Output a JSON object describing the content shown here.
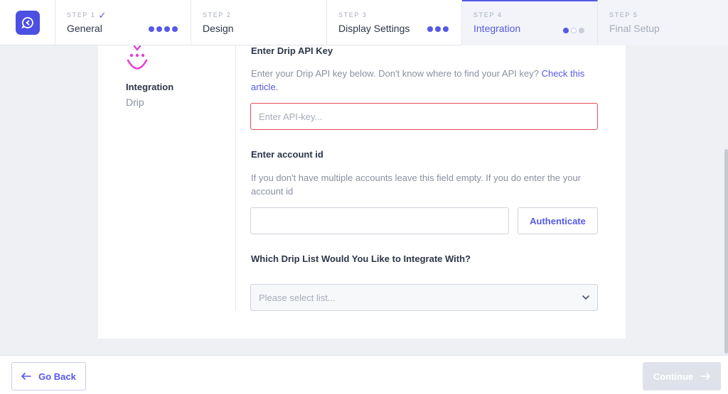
{
  "stepper": {
    "steps": [
      {
        "label": "STEP 1",
        "name": "General"
      },
      {
        "label": "STEP 2",
        "name": "Design"
      },
      {
        "label": "STEP 3",
        "name": "Display Settings"
      },
      {
        "label": "STEP 4",
        "name": "Integration"
      },
      {
        "label": "STEP 5",
        "name": "Final Setup"
      }
    ]
  },
  "sidebar": {
    "title": "Integration",
    "subtitle": "Drip"
  },
  "form": {
    "api_key": {
      "title": "Enter Drip API Key",
      "help": "Enter your Drip API key below. Don't know where to find your API key? ",
      "help_link": "Check this article.",
      "placeholder": "Enter API-key..."
    },
    "account_id": {
      "title": "Enter account id",
      "help": "If you don't have multiple accounts leave this field empty. If you do enter the your account id",
      "value": ""
    },
    "authenticate_label": "Authenticate",
    "list": {
      "title": "Which Drip List Would You Like to Integrate With?",
      "placeholder": "Please select list..."
    }
  },
  "footer": {
    "back_label": "Go Back",
    "continue_label": "Continue"
  },
  "colors": {
    "accent": "#5659e6",
    "error": "#e64d5f",
    "drip_pink": "#e73fd8"
  }
}
